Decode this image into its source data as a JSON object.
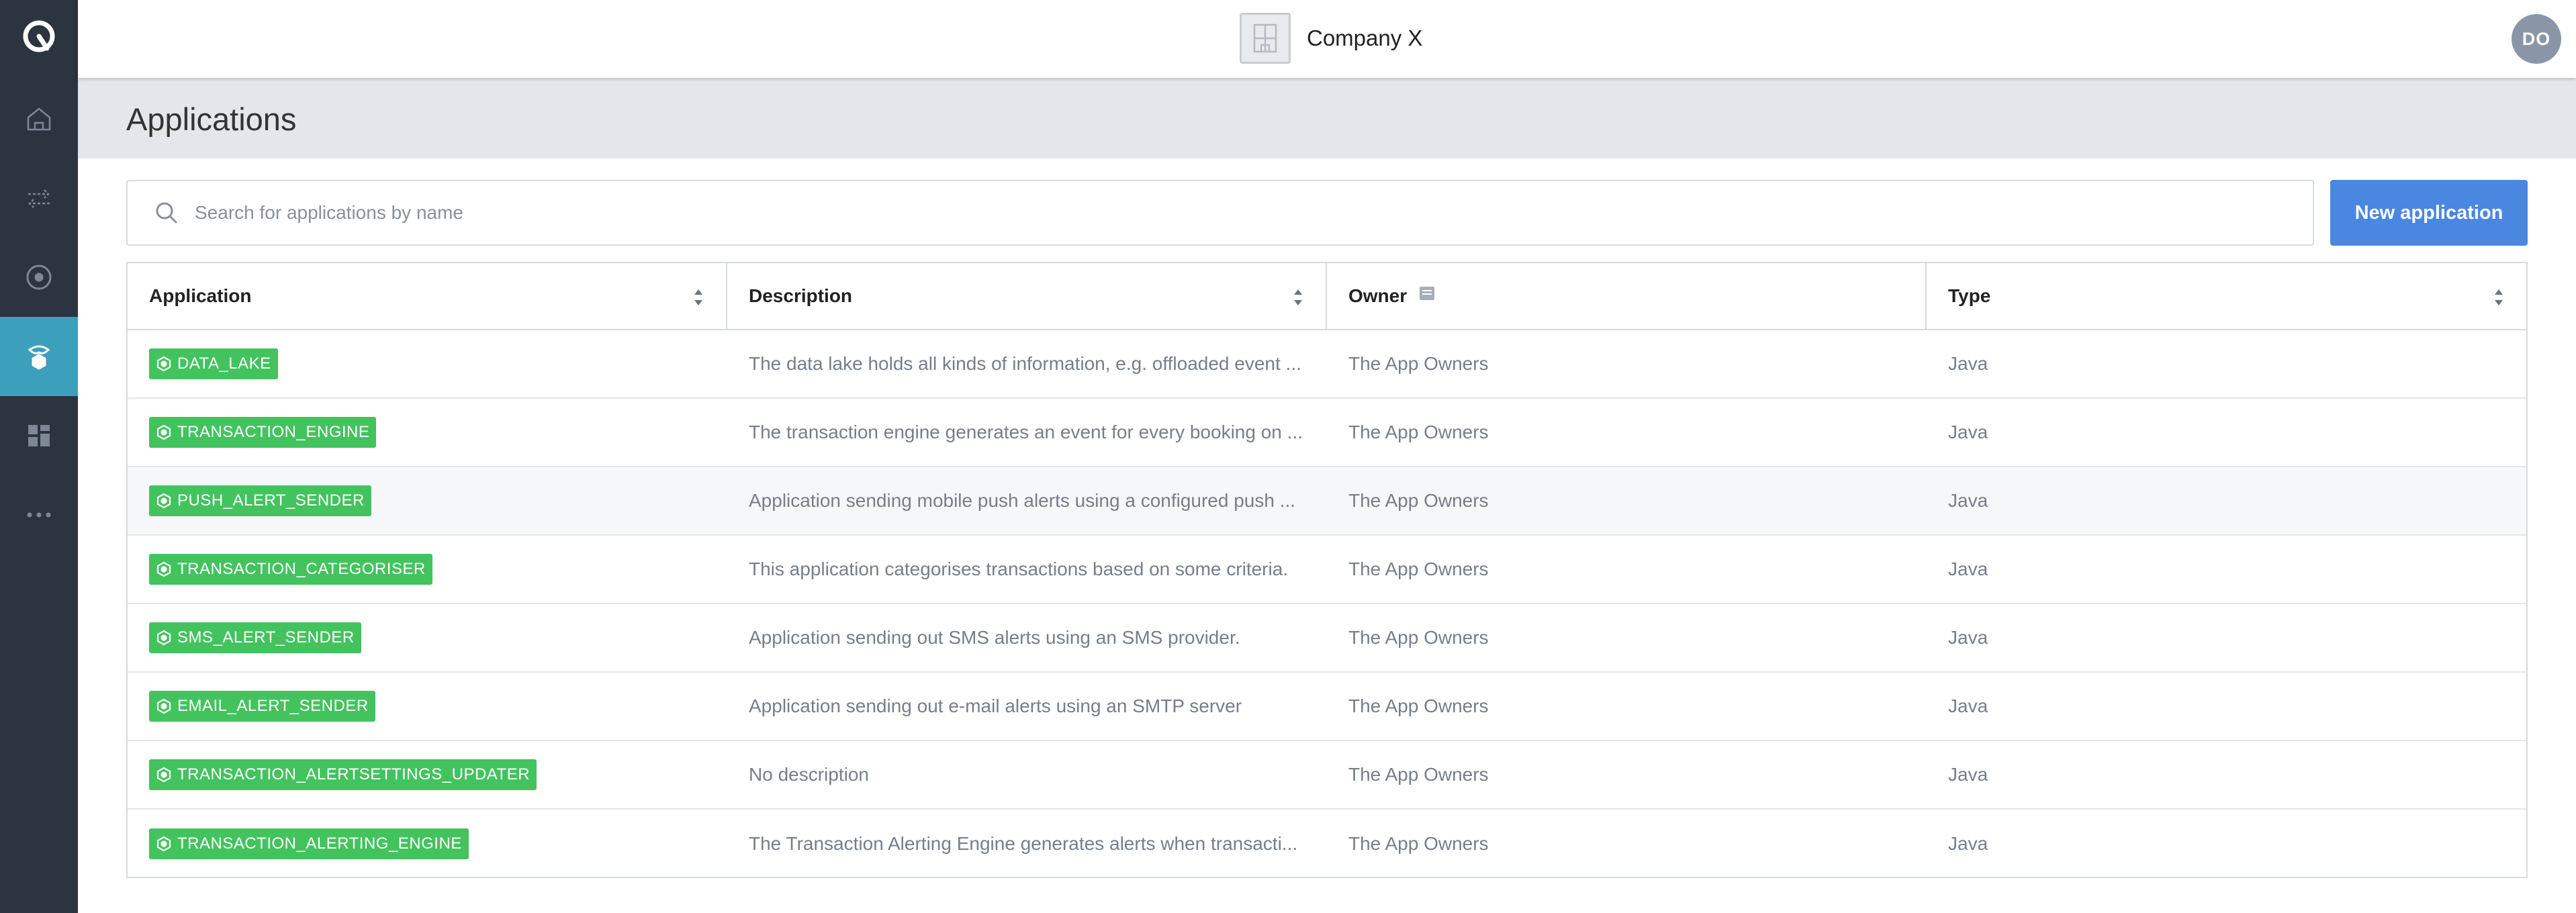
{
  "brand": {
    "accent": "#4a87e0",
    "badge_color": "#43c35e",
    "sidebar_bg": "#2c3440",
    "sidebar_active": "#3c9fbb"
  },
  "sidebar": {
    "items": [
      {
        "icon": "home-icon"
      },
      {
        "icon": "transfer-arrows-icon"
      },
      {
        "icon": "target-circle-icon"
      },
      {
        "icon": "applications-icon",
        "active": true
      },
      {
        "icon": "dashboard-grid-icon"
      },
      {
        "icon": "more-dots-icon"
      }
    ]
  },
  "topbar": {
    "company_name": "Company X",
    "avatar_initials": "DO"
  },
  "page": {
    "title": "Applications"
  },
  "search": {
    "placeholder": "Search for applications by name",
    "value": ""
  },
  "actions": {
    "new_application_label": "New application"
  },
  "table": {
    "columns": [
      {
        "label": "Application",
        "sortable": true
      },
      {
        "label": "Description",
        "sortable": true
      },
      {
        "label": "Owner",
        "sortable": false
      },
      {
        "label": "Type",
        "sortable": true
      }
    ],
    "rows": [
      {
        "application": "DATA_LAKE",
        "description": "The data lake holds all kinds of information, e.g. offloaded event ...",
        "owner": "The App Owners",
        "type": "Java"
      },
      {
        "application": "TRANSACTION_ENGINE",
        "description": "The transaction engine generates an event for every booking on ...",
        "owner": "The App Owners",
        "type": "Java"
      },
      {
        "application": "PUSH_ALERT_SENDER",
        "description": "Application sending mobile push alerts using a configured push ...",
        "owner": "The App Owners",
        "type": "Java"
      },
      {
        "application": "TRANSACTION_CATEGORISER",
        "description": "This application categorises transactions based on some criteria.",
        "owner": "The App Owners",
        "type": "Java"
      },
      {
        "application": "SMS_ALERT_SENDER",
        "description": "Application sending out SMS alerts using an SMS provider.",
        "owner": "The App Owners",
        "type": "Java"
      },
      {
        "application": "EMAIL_ALERT_SENDER",
        "description": "Application sending out e-mail alerts using an SMTP server",
        "owner": "The App Owners",
        "type": "Java"
      },
      {
        "application": "TRANSACTION_ALERTSETTINGS_UPDATER",
        "description": "No description",
        "owner": "The App Owners",
        "type": "Java"
      },
      {
        "application": "TRANSACTION_ALERTING_ENGINE",
        "description": "The Transaction Alerting Engine generates alerts when transacti...",
        "owner": "The App Owners",
        "type": "Java"
      }
    ]
  }
}
